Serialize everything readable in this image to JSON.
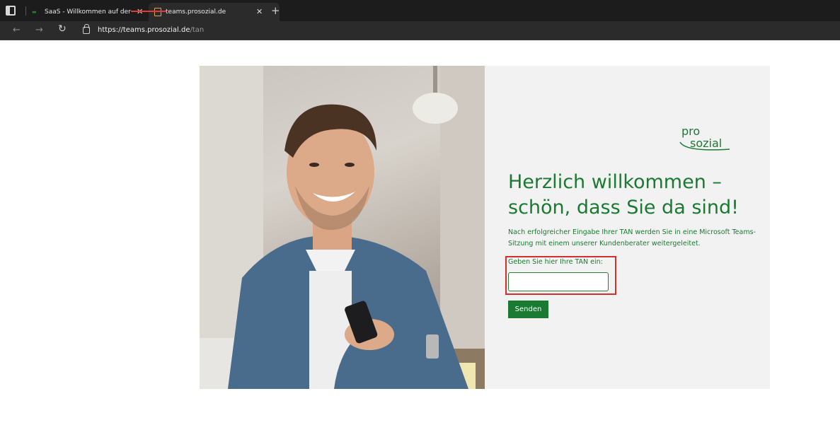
{
  "browser": {
    "tabs": [
      {
        "title": "SaaS - Willkommen auf der SaaS",
        "active": false
      },
      {
        "title": "teams.prosozial.de",
        "active": true
      }
    ],
    "url_host": "https://teams.prosozial.de",
    "url_path": "/tan"
  },
  "page": {
    "logo_text": "prosozial",
    "headline_line1": "Herzlich willkommen –",
    "headline_line2": "schön, dass Sie da sind!",
    "description": "Nach erfolgreicher Eingabe Ihrer TAN werden Sie in eine Microsoft Teams-Sitzung mit einem unserer Kundenberater weitergeleitet.",
    "tan_label": "Geben Sie hier Ihre TAN ein:",
    "tan_value": "",
    "submit_label": "Senden"
  },
  "colors": {
    "brand_green": "#1b7a32",
    "highlight_red": "#d32f2f"
  }
}
